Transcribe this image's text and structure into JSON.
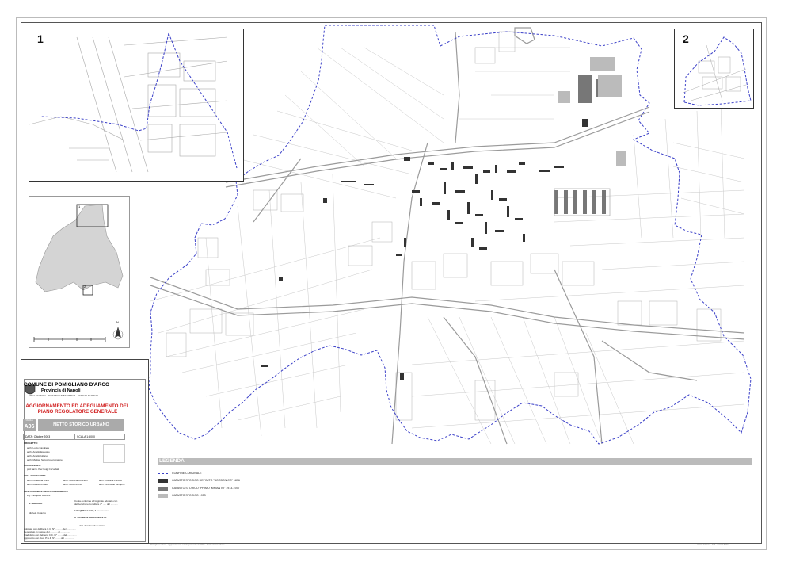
{
  "insets": {
    "one_number": "1",
    "two_number": "2"
  },
  "keymap": {
    "box1_label": "1",
    "box2_label": "2",
    "north_label": "N"
  },
  "titleblock": {
    "municipality": "COMUNE DI POMIGLIANO D'ARCO",
    "province": "Provincia di Napoli",
    "office": "AREA TECNICA - SERVIZIO URBANISTICA - UFFICIO DI PIANO",
    "project_title": "AGGIORNAMENTO ED ADEGUAMENTO DEL PIANO REGOLATORE GENERALE",
    "sheet_code_label": "TAVOLA",
    "sheet_code": "A06",
    "sheet_subject": "NETTO STORICO URBANO",
    "date": "DATA: Ottobre 2003",
    "scale": "SCALA 1:5000",
    "progetto_label": "PROGETTO:",
    "progetto": [
      "arch. Lucio Cavaliere",
      "arch. Aniello Esposito",
      "arch. Aniello Iuliano",
      "arch. Mattias Sacco (coordinatore)"
    ],
    "consulenza_label": "CONSULENZA:",
    "consulenza": "prof. arch. Pier Luigi Cervellati",
    "collab_label": "COLLABORAZIONI:",
    "collab_left": [
      "arch. Loredana Anilio",
      "arch. Massimo Italo"
    ],
    "collab_mid": [
      "arch. Roberta Coscioni",
      "arch. Rosa Miltra"
    ],
    "collab_right": [
      "arch. Floriana Furlullo",
      "arch. Leonardo Mingone"
    ],
    "resp_label": "RESPONSABILE DEL PROCEDIMENTO",
    "resp": "ing. Pasquale Bifulcini",
    "sindaco_label": "IL SINDACO",
    "sindaco": "Michele Caiazzo",
    "copia_text": "Copia conforme all'originale adottato con deliberazione consiliare n° ..... del ...........",
    "pomigliano": "Pomigliano d'Arco, li ..................",
    "segretario_label": "IL SEGRETARIO GENERALE",
    "segretario": "dott. Ferdinando Latorre",
    "approvals": [
      "Adottato con delibera C.C. N° ...........del ..............",
      "Depositato in visione del ........... al ..............",
      "Riadottato con delibera C.C. N° .........del ..............",
      "Approvato con Dec. P.G.P. N° ........del .............."
    ]
  },
  "legend": {
    "title": "LEGENDA",
    "items": [
      {
        "label": "CONFINE COMUNALE",
        "style": "dash",
        "color": "#3b40c8"
      },
      {
        "label": "CATASTO STORICO DEFINITO \"BORBONICO\" 1876",
        "style": "fill",
        "color": "#333333"
      },
      {
        "label": "CATASTO STORICO \"PRIMO IMPIANTO\" 1913-1937",
        "style": "fill",
        "color": "#777777"
      },
      {
        "label": "CATASTO STORICO 1953",
        "style": "fill",
        "color": "#bbbbbb"
      }
    ]
  },
  "footer": {
    "left": "Pomigliano d'Arco - Aggiornamento ed adeguamento del PRG - Netto storico urbano",
    "right": "Ufficio di Piano - A06 - scala 1:5000"
  },
  "colors": {
    "boundary": "#3b40c8",
    "historic_1876": "#333333",
    "historic_1913": "#777777",
    "historic_1953": "#bbbbbb",
    "streets": "#9a9a9a",
    "title_red": "#d12020"
  }
}
